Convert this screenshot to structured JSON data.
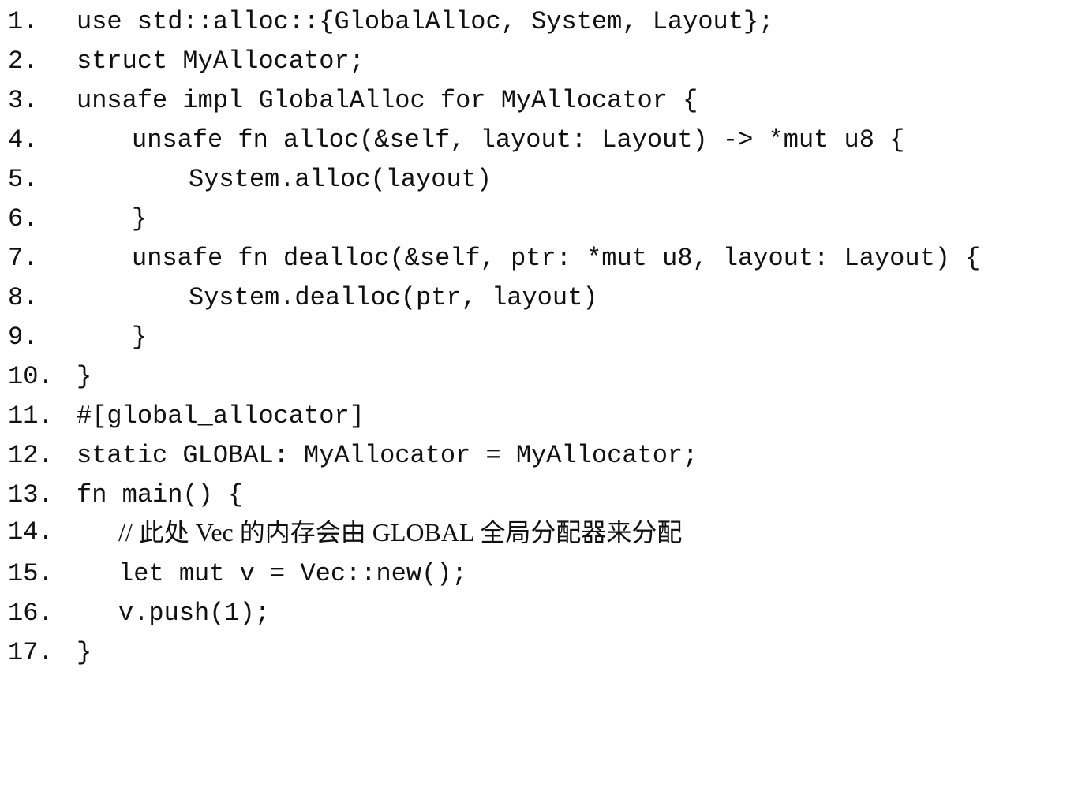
{
  "code": {
    "language": "rust",
    "lines": [
      {
        "number": "1.",
        "text": "use std::alloc::{GlobalAlloc, System, Layout};"
      },
      {
        "number": "2.",
        "text": "struct MyAllocator;"
      },
      {
        "number": "3.",
        "text": "unsafe impl GlobalAlloc for MyAllocator {"
      },
      {
        "number": "4.",
        "text": "unsafe fn alloc(&self, layout: Layout) -> *mut u8 {"
      },
      {
        "number": "5.",
        "text": "System.alloc(layout)"
      },
      {
        "number": "6.",
        "text": "}"
      },
      {
        "number": "7.",
        "text": "unsafe fn dealloc(&self, ptr: *mut u8, layout: Layout) {"
      },
      {
        "number": "8.",
        "text": "System.dealloc(ptr, layout)"
      },
      {
        "number": "9.",
        "text": "}"
      },
      {
        "number": "10.",
        "text": "}"
      },
      {
        "number": "11.",
        "text": "#[global_allocator]"
      },
      {
        "number": "12.",
        "text": "static GLOBAL: MyAllocator = MyAllocator;"
      },
      {
        "number": "13.",
        "text": "fn main() {"
      },
      {
        "number": "14.",
        "text": "// 此处 Vec 的内存会由 GLOBAL 全局分配器来分配"
      },
      {
        "number": "15.",
        "text": "let mut v = Vec::new();"
      },
      {
        "number": "16.",
        "text": "v.push(1);"
      },
      {
        "number": "17.",
        "text": "}"
      }
    ]
  }
}
